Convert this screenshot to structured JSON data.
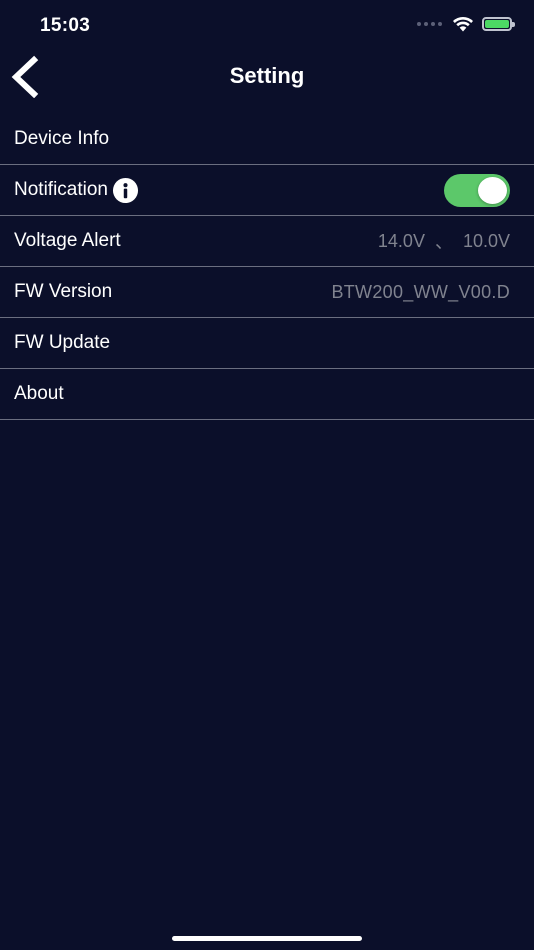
{
  "status_bar": {
    "time": "15:03",
    "icons": [
      "signal-dots-icon",
      "wifi-icon",
      "battery-icon"
    ],
    "battery_color": "#4cd964"
  },
  "nav": {
    "title": "Setting",
    "back_icon": "chevron-left-icon"
  },
  "settings": {
    "device_info": {
      "label": "Device Info"
    },
    "notification": {
      "label": "Notification",
      "info_icon": "info-icon",
      "toggle_on": true,
      "toggle_color": "#5cc86a"
    },
    "voltage_alert": {
      "label": "Voltage Alert",
      "high": "14.0V",
      "separator": "、",
      "low": "10.0V"
    },
    "fw_version": {
      "label": "FW Version",
      "value": "BTW200_WW_V00.D"
    },
    "fw_update": {
      "label": "FW Update"
    },
    "about": {
      "label": "About"
    }
  },
  "colors": {
    "background": "#0b0f2a",
    "divider": "#6b6e80",
    "secondary_text": "#80838f"
  }
}
